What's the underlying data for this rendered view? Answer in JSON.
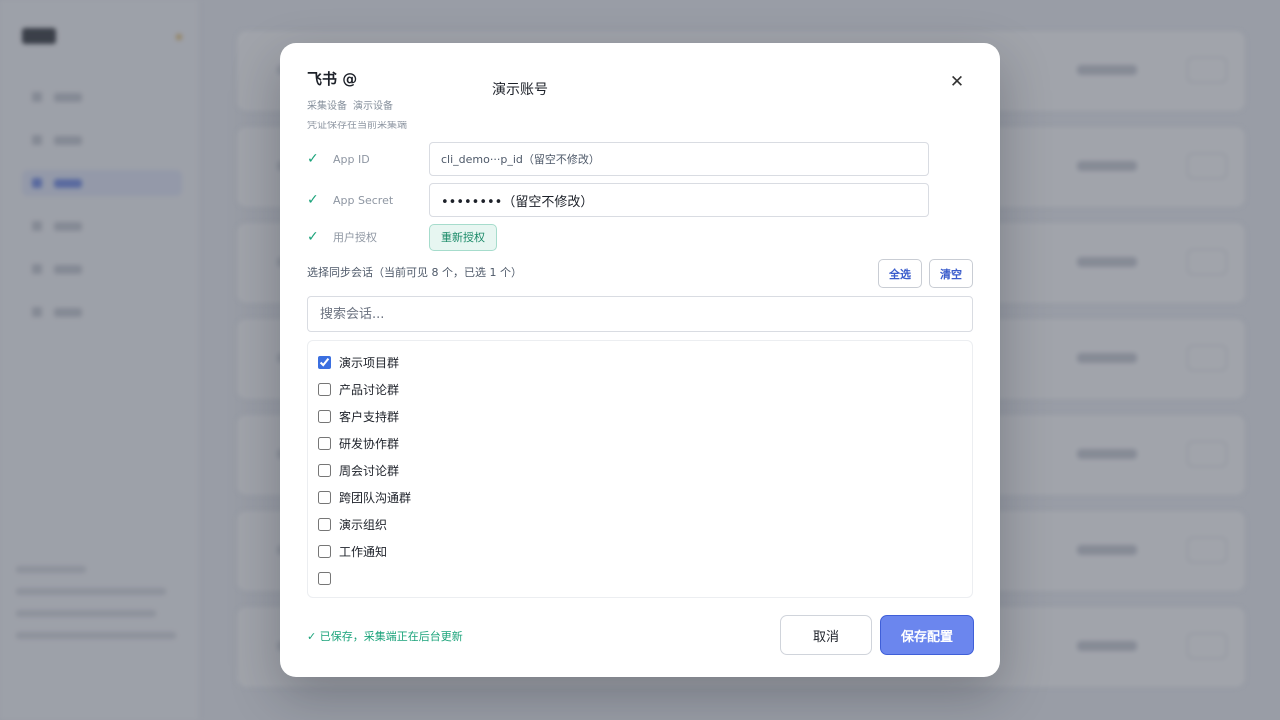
{
  "modal": {
    "title": "飞书 @",
    "account": "演示账号",
    "subtitle_1": "采集设备",
    "subtitle_2": "演示设备",
    "hint": "凭证保存在当前采集端",
    "close_icon": "close-icon"
  },
  "fields": {
    "app_id": {
      "label": "App ID",
      "value": "cli_demo···p_id（留空不修改）"
    },
    "app_secret": {
      "label": "App Secret",
      "value": "••••••••（留空不修改）"
    },
    "user_auth": {
      "label": "用户授权",
      "button": "重新授权"
    },
    "check_icon": "✓",
    "check_color": "#1aa37a"
  },
  "selection": {
    "title": "选择同步会话（当前可见 8 个，已选 1 个）",
    "select_all": "全选",
    "clear": "清空",
    "search_placeholder": "搜索会话...",
    "items": [
      {
        "label": "演示项目群",
        "checked": true
      },
      {
        "label": "产品讨论群",
        "checked": false
      },
      {
        "label": "客户支持群",
        "checked": false
      },
      {
        "label": "研发协作群",
        "checked": false
      },
      {
        "label": "周会讨论群",
        "checked": false
      },
      {
        "label": "跨团队沟通群",
        "checked": false
      },
      {
        "label": "演示组织",
        "checked": false
      },
      {
        "label": "工作通知",
        "checked": false
      },
      {
        "label": "",
        "checked": false
      },
      {
        "label": "",
        "checked": false
      }
    ]
  },
  "footer": {
    "saved_status": "✓ 已保存，采集端正在后台更新",
    "cancel": "取消",
    "save": "保存配置"
  },
  "colors": {
    "accent": "#6b86ee",
    "success": "#1aa37a",
    "overlay": "rgba(75, 80, 94, 0.52)"
  }
}
